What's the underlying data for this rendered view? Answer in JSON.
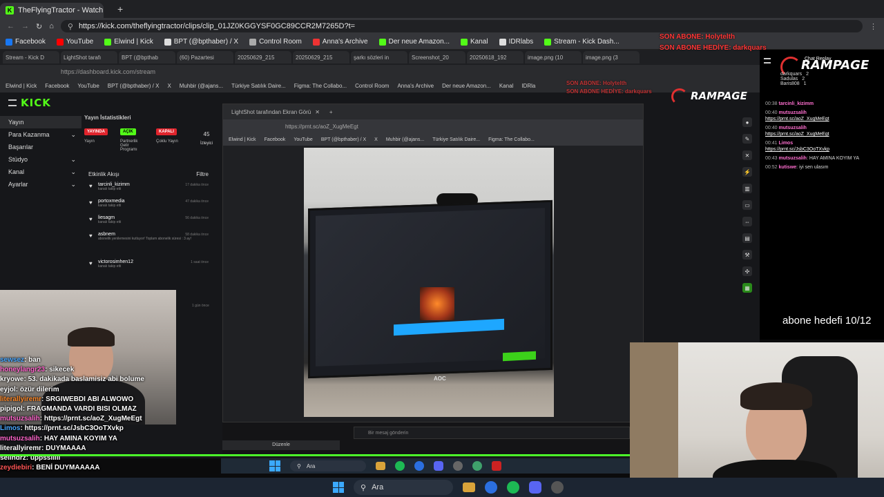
{
  "outer_browser": {
    "tab_title": "TheFlyingTractor - Watch clips o",
    "url": "https://kick.com/theflyingtractor/clips/clip_01JZ0KGGYSF0GC89CCR2M7265D?t=",
    "bookmarks": [
      "Facebook",
      "YouTube",
      "Elwind | Kick",
      "BPT (@bpthaber) / X",
      "Control Room",
      "Anna's Archive",
      "Der neue Amazon...",
      "Kanal",
      "IDRlabs",
      "Stream - Kick Dash..."
    ]
  },
  "inner_browser": {
    "tabs": [
      "Stream - Kick D",
      "LightShot tarafı",
      "BPT (@bpthab",
      "(60) Pazartesi",
      "20250629_215",
      "20250629_215",
      "şarkı sözleri in",
      "Screenshot_20",
      "20250618_192",
      "image.png (10",
      "image.png (3"
    ],
    "url": "https://dashboard.kick.com/stream",
    "bookmarks": [
      "Elwind | Kick",
      "Facebook",
      "YouTube",
      "BPT (@bpthaber) / X",
      "X",
      "Muhbir (@ajans...",
      "Türkiye Satılık Daire...",
      "Figma: The Collabo...",
      "Control Room",
      "Anna's Archive",
      "Der neue Amazon...",
      "Kanal",
      "IDRla"
    ]
  },
  "dashboard": {
    "logo": "KICK",
    "sidebar": [
      {
        "label": "Yayın",
        "chev": ""
      },
      {
        "label": "Para Kazanma",
        "chev": "⌄"
      },
      {
        "label": "Başarılar",
        "chev": ""
      },
      {
        "label": "Stüdyo",
        "chev": "⌄"
      },
      {
        "label": "Kanal",
        "chev": "⌄"
      },
      {
        "label": "Ayarlar",
        "chev": "⌄"
      }
    ],
    "stats_title": "Yayın İstatistikleri",
    "stats": [
      {
        "pill": "YAYINDA",
        "sub": "Yayın",
        "color": "#e0242c"
      },
      {
        "pill": "AÇIK",
        "sub": "Partnerlik Gelir Programı",
        "color": "#53fc18"
      },
      {
        "pill": "KAPALI",
        "sub": "Çoklu Yayın",
        "color": "#e0242c"
      }
    ],
    "viewers": "45",
    "viewers_label": "İzleyici",
    "feed_title": "Etkinlik Akışı",
    "feed_filter": "Filtre",
    "feed": [
      {
        "user": "tarcinli_kizimm",
        "action": "kanalı takip etti",
        "time": "17 dakika önce"
      },
      {
        "user": "portoxmedia",
        "action": "kanalı takip etti",
        "time": "47 dakika önce"
      },
      {
        "user": "liesagm",
        "action": "kanalı takip etti",
        "time": "56 dakika önce"
      },
      {
        "user": "asbnem",
        "action": "abonelik yenilemesini kutluyor! Toplam abonelik süresi : 3 ay!",
        "time": "58 dakika önce"
      },
      {
        "user": "victorosimhen12",
        "action": "kanalı takip etti",
        "time": "1 saat önce"
      }
    ],
    "feed_last_time": "1 gün önce",
    "chat_placeholder": "Bir mesaj gönderin",
    "edit_label": "Düzenle"
  },
  "lightshot": {
    "tab_title": "LightShot tarafından Ekran Görü",
    "url": "https://prnt.sc/aoZ_XugMeEgt",
    "bookmarks": [
      "Elwind | Kick",
      "Facebook",
      "YouTube",
      "BPT (@bpthaber) / X",
      "X",
      "Muhbir (@ajans...",
      "Türkiye Satılık Daire...",
      "Figma: The Collabo..."
    ],
    "monitor_brand": "AOC"
  },
  "overlay": {
    "last_sub": "SON ABONE: Holytelth",
    "last_sub_gift": "SON ABONE HEDİYE: darkquars",
    "chat_replay_title": "Chat Replay",
    "brand": "RAMPAGE",
    "top_supporters": [
      {
        "name": "darkquars",
        "count": "2"
      },
      {
        "name": "Sadulas",
        "count": "2"
      },
      {
        "name": "Baris808",
        "count": "1"
      }
    ],
    "sub_goal": "abone hedefi 10/12"
  },
  "chat_replay": [
    {
      "time": "00:38",
      "user": "tarcinli_kizimm",
      "msg": ""
    },
    {
      "time": "00:40",
      "user": "mutsuzsalih",
      "msg": "https://prnt.sc/aoZ_XugMeEgt"
    },
    {
      "time": "00:40",
      "user": "mutsuzsalih",
      "msg": "https://prnt.sc/aoZ_XugMeEgt"
    },
    {
      "time": "00:41",
      "user": "Limos",
      "msg": "https://prnt.sc/JsbC3OoTXvkp"
    },
    {
      "time": "00:43",
      "user": "mutsuzsalih",
      "msg": "HAY AMINA KOYIM YA"
    },
    {
      "time": "00:52",
      "user": "kutiswe",
      "msg": "iyi sen ulasım"
    }
  ],
  "stream_chat": [
    {
      "user": "sewsez",
      "msg": "ban",
      "color": "#4aa8ff"
    },
    {
      "user": "honeylangr23",
      "msg": "sikecek",
      "color": "#ff66cc"
    },
    {
      "user": "kryowe",
      "msg": "53. dakikada baslamisiz abi bolume",
      "color": "#ffffff"
    },
    {
      "user": "eyjol",
      "msg": "özür dilerim",
      "color": "#ffffff"
    },
    {
      "user": "literallyiremr",
      "msg": "SRGIWEBDI ABI ALWOWO",
      "color": "#ff8a2a"
    },
    {
      "user": "pipigol",
      "msg": "FRAGMANDA VARDI BISI OLMAZ",
      "color": "#ffffff"
    },
    {
      "user": "mutsuzsalih",
      "msg": "https://prnt.sc/aoZ_XugMeEgt",
      "color": "#ff66cc"
    },
    {
      "user": "Limos",
      "msg": "https://prnt.sc/JsbC3OoTXvkp",
      "color": "#4aa8ff"
    },
    {
      "user": "mutsuzsalih",
      "msg": "HAY AMINA KOYIM YA",
      "color": "#ff66cc"
    },
    {
      "user": "literallyiremr",
      "msg": "DUYMAAAA",
      "color": "#ffffff"
    },
    {
      "user": "selindrz",
      "msg": "uppssiiiii",
      "color": "#ffffff"
    },
    {
      "user": "zeydiebiri",
      "msg": "BENİ DUYMAAAAA",
      "color": "#ff5555"
    }
  ],
  "taskbar": {
    "search": "Ara"
  }
}
